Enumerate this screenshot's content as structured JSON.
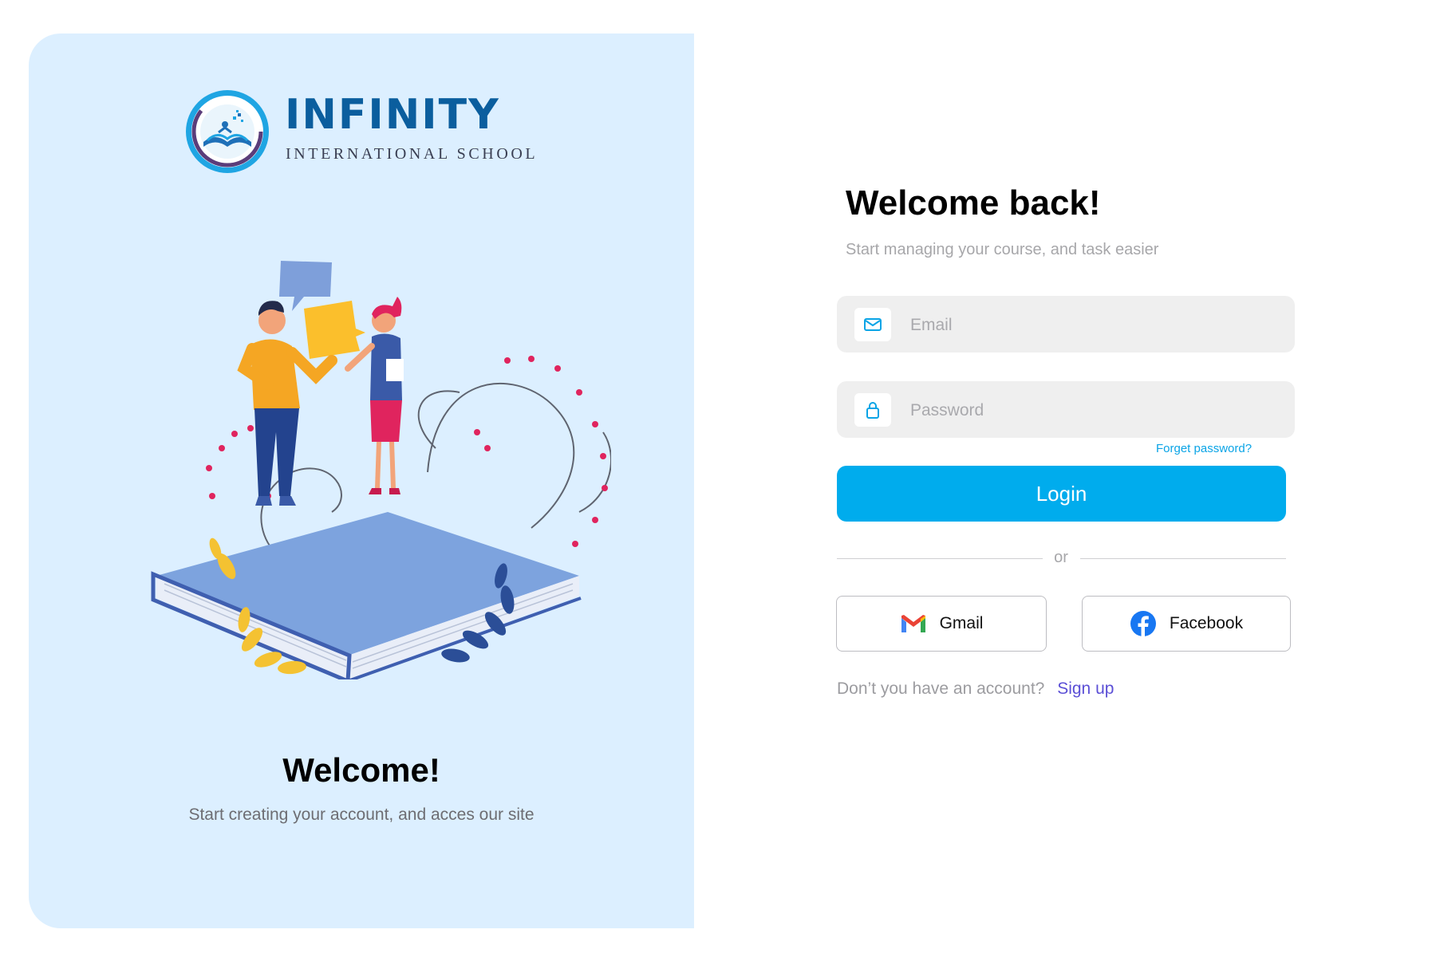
{
  "brand": {
    "name": "INFINITY",
    "subtitle": "INTERNATIONAL SCHOOL",
    "primary_color": "#0b5e9e",
    "accent_color": "#1fa5e3"
  },
  "left": {
    "title": "Welcome!",
    "subtitle": "Start creating your account, and acces our site",
    "background": "#dcefff"
  },
  "login": {
    "title": "Welcome back!",
    "subtitle": "Start managing your course, and task easier",
    "email": {
      "placeholder": "Email",
      "value": "",
      "icon": "mail-icon"
    },
    "password": {
      "placeholder": "Password",
      "value": "",
      "icon": "lock-icon"
    },
    "forgot_label": "Forget password?",
    "login_label": "Login",
    "login_color": "#00aced",
    "divider_label": "or",
    "gmail_label": "Gmail",
    "facebook_label": "Facebook",
    "signup_question": "Don’t you have an account?",
    "signup_label": "Sign up"
  }
}
